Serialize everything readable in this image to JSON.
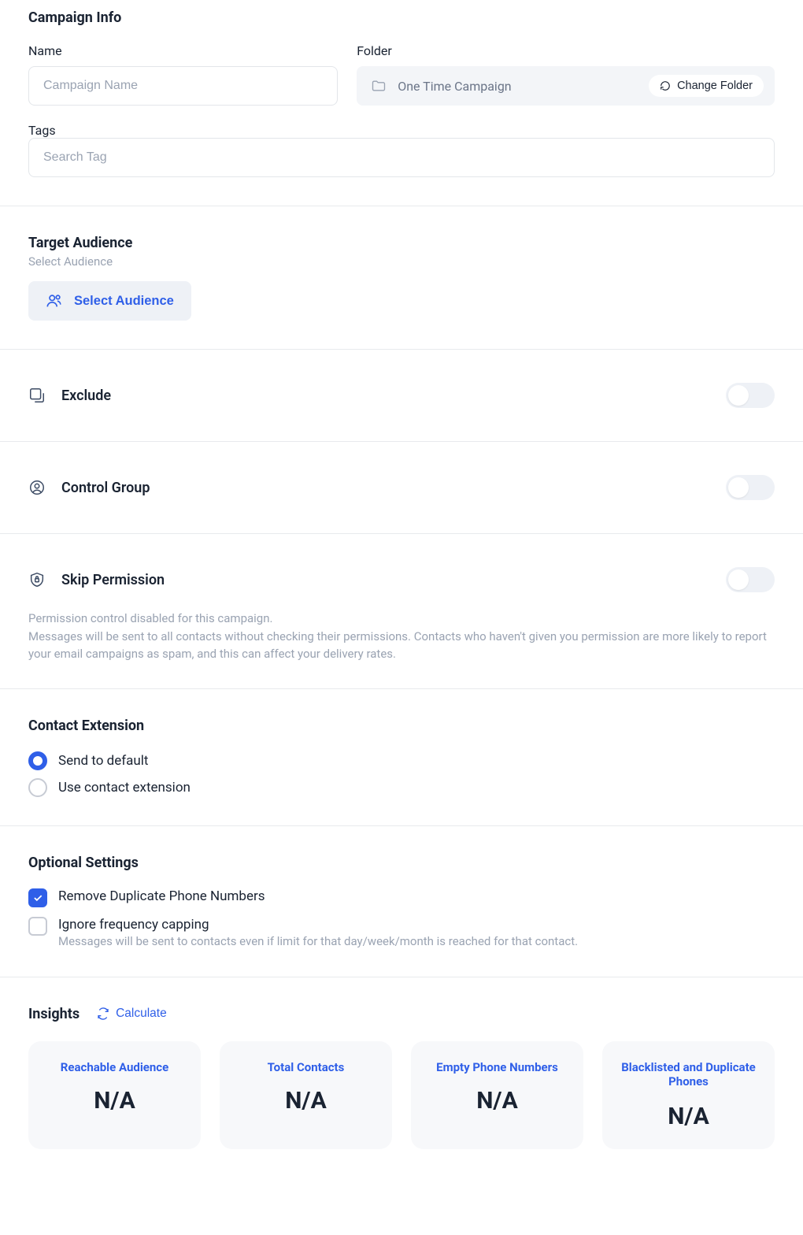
{
  "campaignInfo": {
    "header": "Campaign Info",
    "name": {
      "label": "Name",
      "placeholder": "Campaign Name"
    },
    "folder": {
      "label": "Folder",
      "value": "One Time Campaign",
      "changeBtn": "Change Folder"
    },
    "tags": {
      "label": "Tags",
      "placeholder": "Search Tag"
    }
  },
  "targetAudience": {
    "header": "Target Audience",
    "sub": "Select Audience",
    "btn": "Select Audience"
  },
  "exclude": {
    "label": "Exclude"
  },
  "controlGroup": {
    "label": "Control Group"
  },
  "skipPermission": {
    "label": "Skip Permission",
    "desc1": "Permission control disabled for this campaign.",
    "desc2": "Messages will be sent to all contacts without checking their permissions. Contacts who haven't given you permission are more likely to report your email campaigns as spam, and this can affect your delivery rates."
  },
  "contactExtension": {
    "header": "Contact Extension",
    "opt1": "Send to default",
    "opt2": "Use contact extension"
  },
  "optionalSettings": {
    "header": "Optional Settings",
    "removeDup": "Remove Duplicate Phone Numbers",
    "ignoreCap": "Ignore frequency capping",
    "ignoreCapSub": "Messages will be sent to contacts even if limit for that day/week/month is reached for that contact."
  },
  "insights": {
    "header": "Insights",
    "calcBtn": "Calculate",
    "cards": [
      {
        "title": "Reachable Audience",
        "value": "N/A"
      },
      {
        "title": "Total Contacts",
        "value": "N/A"
      },
      {
        "title": "Empty Phone Numbers",
        "value": "N/A"
      },
      {
        "title": "Blacklisted and Duplicate Phones",
        "value": "N/A"
      }
    ]
  }
}
